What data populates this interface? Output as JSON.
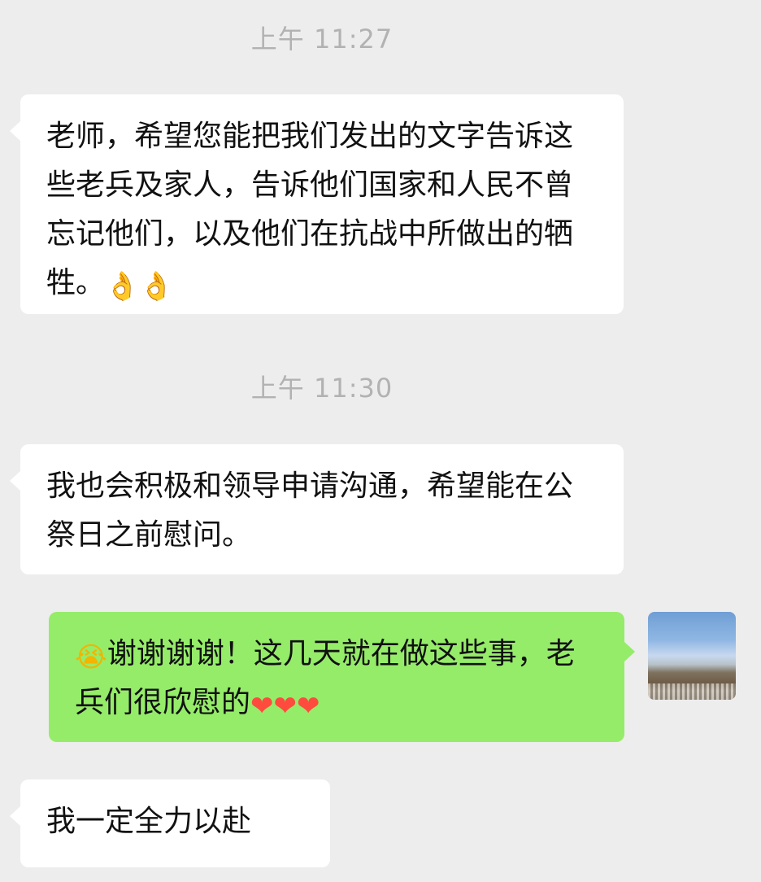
{
  "conversation": {
    "timestamps": [
      "上午 11:27",
      "上午 11:30"
    ],
    "messages": [
      {
        "side": "incoming",
        "text": "老师，希望您能把我们发出的文字告诉这些老兵及家人，告诉他们国家和人民不曾忘记他们，以及他们在抗战中所做出的牺牲。",
        "emoji": "👌👌",
        "emoji_icons": [
          "ok-hand-icon",
          "ok-hand-icon"
        ]
      },
      {
        "side": "incoming",
        "text": "我也会积极和领导申请沟通，希望能在公祭日之前慰问。"
      },
      {
        "side": "outgoing",
        "lead_emoji": "😭",
        "lead_icon": "crying-face-icon",
        "text": "谢谢谢谢！这几天就在做这些事，老兵们很欣慰的",
        "emoji": "❤❤❤",
        "emoji_icons": [
          "heart-icon",
          "heart-icon",
          "heart-icon"
        ]
      },
      {
        "side": "incoming",
        "text": "我一定全力以赴"
      }
    ]
  },
  "colors": {
    "background": "#ededed",
    "incoming_bubble": "#ffffff",
    "outgoing_bubble": "#95ec69",
    "timestamp_text": "#b2b2b2"
  }
}
